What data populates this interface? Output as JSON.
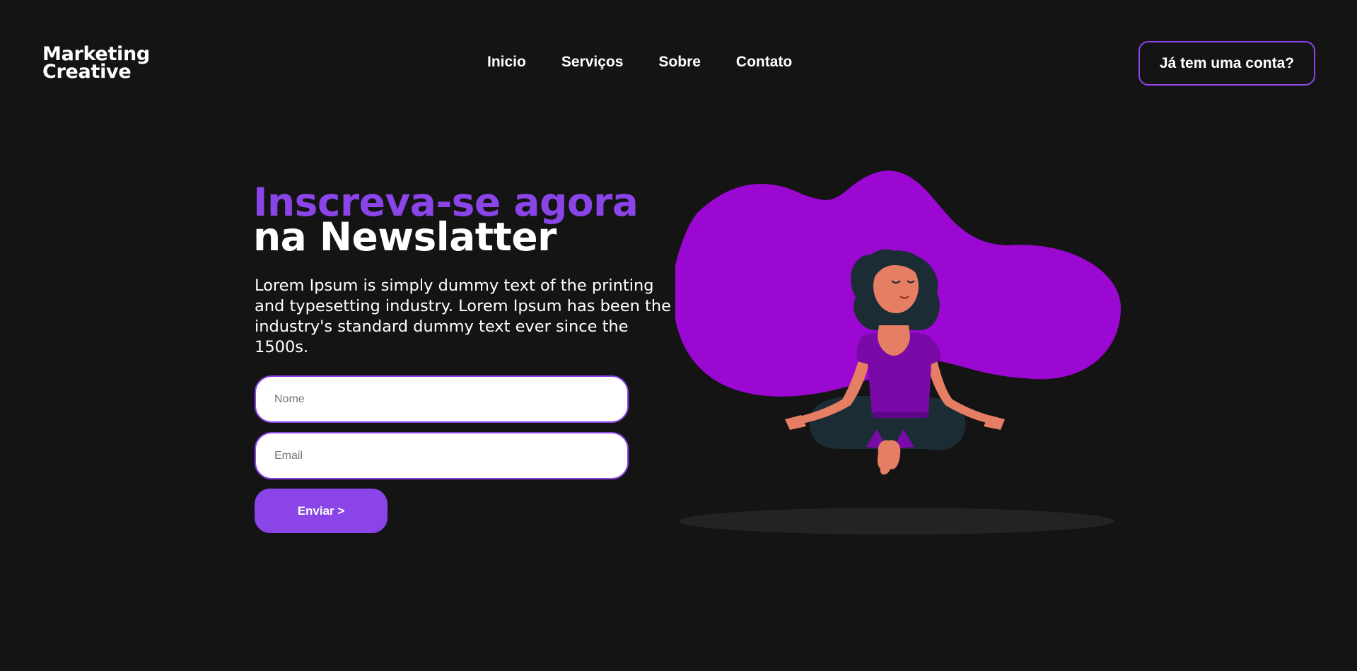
{
  "header": {
    "logo_line1": "Marketing",
    "logo_line2": "Creative",
    "nav": [
      {
        "label": "Inicio"
      },
      {
        "label": "Serviços"
      },
      {
        "label": "Sobre"
      },
      {
        "label": "Contato"
      }
    ],
    "account_button": "Já tem uma conta?"
  },
  "hero": {
    "title_accent": "Inscreva-se agora",
    "title_main": "na Newslatter",
    "description": "Lorem Ipsum is simply dummy text of the printing and typesetting industry. Lorem Ipsum has been the industry's standard dummy text ever since the 1500s.",
    "form": {
      "name_placeholder": "Nome",
      "email_placeholder": "Email",
      "submit_label": "Enviar >"
    }
  },
  "colors": {
    "background": "#141414",
    "accent": "#8a44e8",
    "blob": "#9b08d2",
    "text": "#ffffff"
  }
}
